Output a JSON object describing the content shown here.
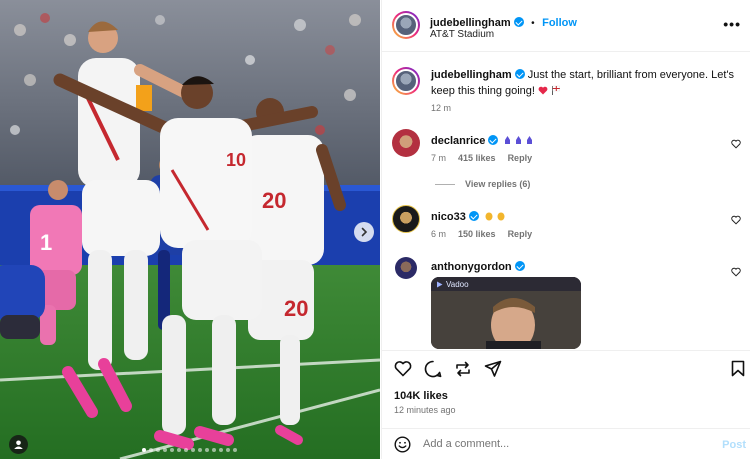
{
  "post": {
    "username": "judebellingham",
    "follow_label": "Follow",
    "separator": "•",
    "location": "AT&T Stadium",
    "more_label": "•••"
  },
  "photo": {
    "jersey_numbers": [
      "10",
      "20",
      "20",
      "1"
    ]
  },
  "caption": {
    "username": "judebellingham",
    "text": "Just the start, brilliant from everyone. Let's keep this thing going!",
    "emojis": [
      "red-heart",
      "england-flag"
    ],
    "time": "12 m"
  },
  "comments": [
    {
      "username": "declanrice",
      "text": "",
      "emojis": [
        "lion-crest",
        "lion-crest",
        "lion-crest"
      ],
      "time": "7 m",
      "likes": "415 likes",
      "reply_label": "Reply",
      "view_replies": "View replies (6)"
    },
    {
      "username": "nico33",
      "text": "",
      "emojis": [
        "clapping-hands",
        "clapping-hands"
      ],
      "time": "6 m",
      "likes": "150 likes",
      "reply_label": "Reply"
    },
    {
      "username": "anthonygordon",
      "gif_label": "Vadoo"
    }
  ],
  "engagement": {
    "likes": "104K likes",
    "time_ago": "12 minutes ago"
  },
  "composer": {
    "placeholder": "Add a comment...",
    "post_label": "Post"
  },
  "colors": {
    "accent_blue": "#0095f6",
    "muted": "#737373",
    "divider": "#efefef"
  }
}
